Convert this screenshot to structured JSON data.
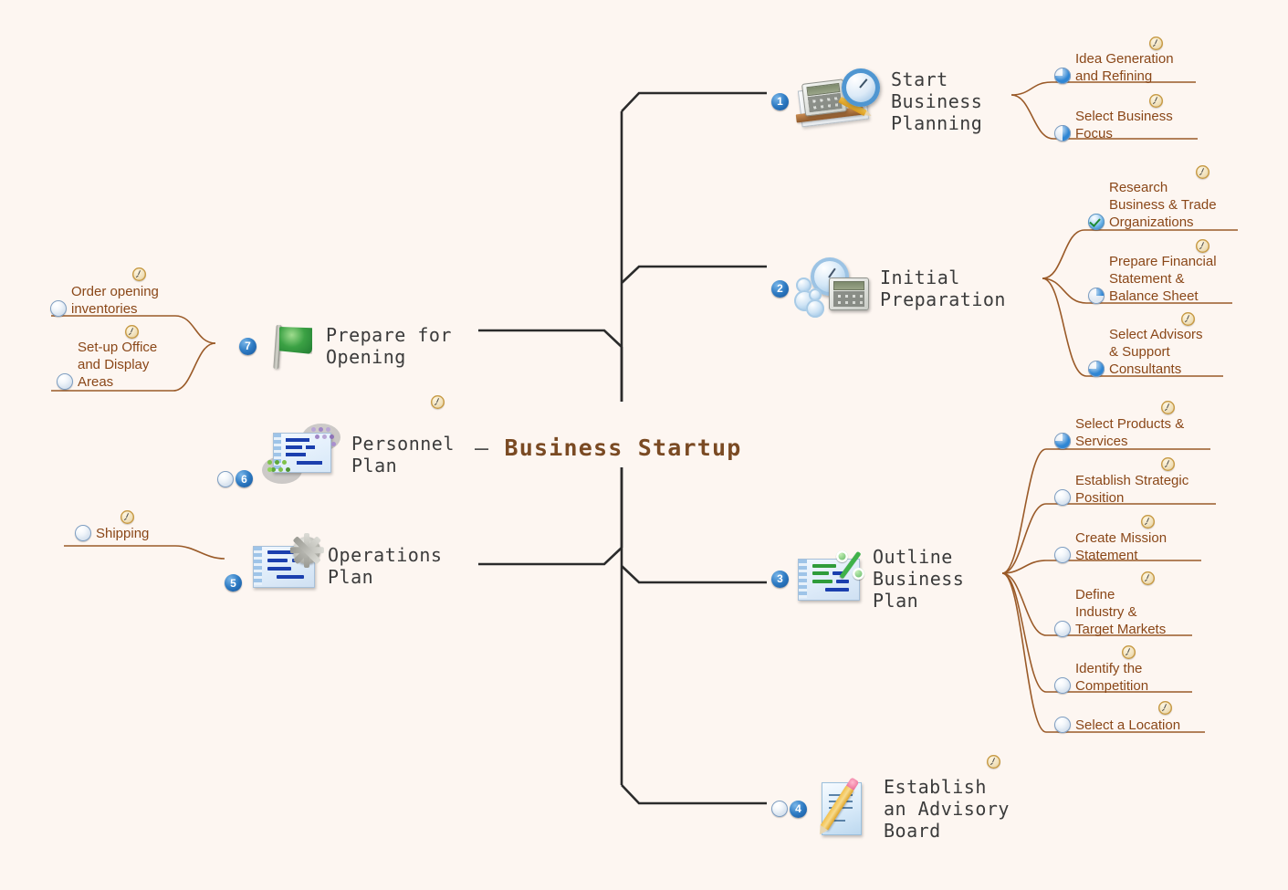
{
  "diagram": {
    "title": "Business Startup",
    "root_dash": "—",
    "background_color": "#fdf6f1",
    "root_text_color": "#7a4a23",
    "topic_text_color": "#3b3b3b",
    "subtopic_text_color": "#8a4718",
    "branch_line_color": "#2b2b2b",
    "subbranch_line_color": "#9a5a28",
    "badge_color": "#2f7cc4",
    "progress_color": "#2f86d4",
    "done_color": "#1d8a33"
  },
  "topics": [
    {
      "id": "start-business-planning",
      "number": "1",
      "label": "Start\nBusiness\nPlanning",
      "icon": "calculator-ruler-magnifier-icon",
      "side": "right",
      "has_progress": false,
      "clock": true,
      "subtopics": [
        {
          "label": "Idea Generation\nand Refining",
          "progress": 75,
          "clock": true
        },
        {
          "label": "Select Business\nFocus",
          "progress": 50,
          "clock": true
        }
      ]
    },
    {
      "id": "initial-preparation",
      "number": "2",
      "label": "Initial\nPreparation",
      "icon": "clock-calculator-people-icon",
      "side": "right",
      "has_progress": false,
      "clock": false,
      "subtopics": [
        {
          "label": "Research\nBusiness & Trade\nOrganizations",
          "progress": 100,
          "done": true,
          "clock": true
        },
        {
          "label": "Prepare Financial\nStatement &\nBalance Sheet",
          "progress": 25,
          "clock": true
        },
        {
          "label": "Select Advisors\n& Support\nConsultants",
          "progress": 75,
          "clock": true
        }
      ]
    },
    {
      "id": "outline-business-plan",
      "number": "3",
      "label": "Outline\nBusiness\nPlan",
      "icon": "gantt-percent-icon",
      "side": "right",
      "has_progress": false,
      "clock": false,
      "subtopics": [
        {
          "label": "Select Products &\nServices",
          "progress": 75,
          "clock": true
        },
        {
          "label": "Establish Strategic\nPosition",
          "progress": 0,
          "clock": true
        },
        {
          "label": "Create Mission\nStatement",
          "progress": 0,
          "clock": true
        },
        {
          "label": "Define\nIndustry &\nTarget Markets",
          "progress": 0,
          "clock": true
        },
        {
          "label": "Identify the\nCompetition",
          "progress": 0,
          "clock": true
        },
        {
          "label": "Select a Location",
          "progress": 0,
          "clock": true
        }
      ]
    },
    {
      "id": "establish-advisory-board",
      "number": "4",
      "label": "Establish\nan Advisory\nBoard",
      "icon": "document-pencil-icon",
      "side": "right",
      "has_progress": true,
      "progress": 0,
      "clock": true,
      "subtopics": []
    },
    {
      "id": "operations-plan",
      "number": "5",
      "label": "Operations\nPlan",
      "icon": "gantt-gear-icon",
      "side": "left",
      "has_progress": false,
      "clock": false,
      "subtopics": [
        {
          "label": "Shipping",
          "progress": 0,
          "clock": true
        }
      ]
    },
    {
      "id": "personnel-plan",
      "number": "6",
      "label": "Personnel\nPlan",
      "icon": "gantt-people-icon",
      "side": "left",
      "has_progress": true,
      "progress": 0,
      "clock": true,
      "subtopics": []
    },
    {
      "id": "prepare-for-opening",
      "number": "7",
      "label": "Prepare for\nOpening",
      "icon": "green-flag-icon",
      "side": "left",
      "has_progress": false,
      "clock": false,
      "subtopics": [
        {
          "label": "Order opening\ninventories",
          "progress": 0,
          "clock": true
        },
        {
          "label": "Set-up Office\nand Display\nAreas",
          "progress": 0,
          "clock": true
        }
      ]
    }
  ]
}
